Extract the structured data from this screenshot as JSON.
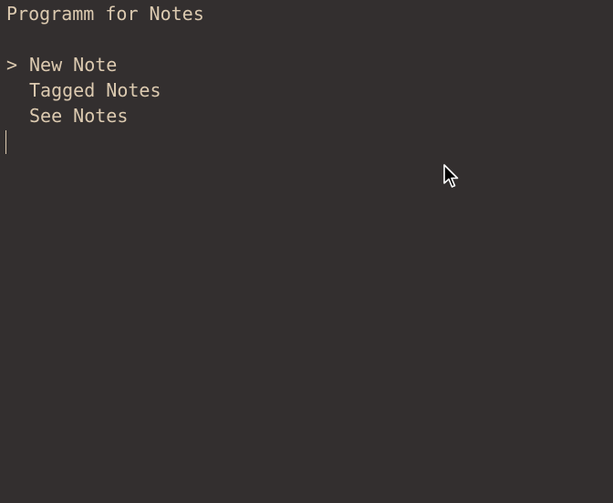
{
  "app": {
    "title": "Programm for Notes"
  },
  "menu": {
    "selector_glyph": ">",
    "items": [
      {
        "label": "New Note",
        "selected": true
      },
      {
        "label": "Tagged Notes",
        "selected": false
      },
      {
        "label": "See Notes",
        "selected": false
      }
    ]
  },
  "colors": {
    "background": "#332f2f",
    "text": "#dccab0"
  },
  "icons": {
    "pointer": "mouse-pointer-icon",
    "cursor": "text-cursor"
  }
}
